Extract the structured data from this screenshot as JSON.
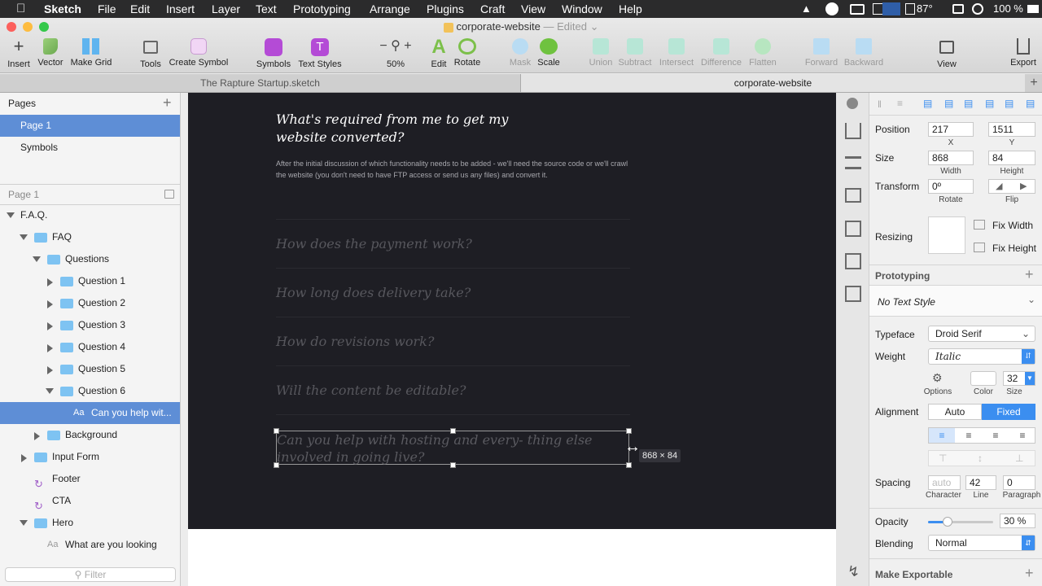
{
  "menubar": {
    "app": "Sketch",
    "items": [
      "File",
      "Edit",
      "Insert",
      "Layer",
      "Text",
      "Prototyping",
      "Arrange",
      "Plugins",
      "Craft",
      "View",
      "Window",
      "Help"
    ],
    "temperature": "87°",
    "battery": "100 %"
  },
  "window": {
    "title": "corporate-website",
    "edited": "— Edited"
  },
  "toolbar": {
    "insert": "Insert",
    "vector": "Vector",
    "make_grid": "Make Grid",
    "tools": "Tools",
    "create_symbol": "Create Symbol",
    "symbols": "Symbols",
    "text_styles": "Text Styles",
    "zoom": "50%",
    "edit": "Edit",
    "rotate": "Rotate",
    "mask": "Mask",
    "scale": "Scale",
    "union": "Union",
    "subtract": "Subtract",
    "intersect": "Intersect",
    "difference": "Difference",
    "flatten": "Flatten",
    "forward": "Forward",
    "backward": "Backward",
    "view": "View",
    "export": "Export"
  },
  "tabs": [
    "The Rapture Startup.sketch",
    "corporate-website"
  ],
  "pages": {
    "header": "Pages",
    "items": [
      "Page 1",
      "Symbols"
    ],
    "current": "Page 1"
  },
  "layers": [
    {
      "label": "F.A.Q.",
      "indent": 0,
      "type": "page"
    },
    {
      "label": "FAQ",
      "indent": 1,
      "type": "folder",
      "open": true
    },
    {
      "label": "Questions",
      "indent": 2,
      "type": "folder",
      "open": true
    },
    {
      "label": "Question 1",
      "indent": 3,
      "type": "folder"
    },
    {
      "label": "Question 2",
      "indent": 3,
      "type": "folder"
    },
    {
      "label": "Question 3",
      "indent": 3,
      "type": "folder"
    },
    {
      "label": "Question 4",
      "indent": 3,
      "type": "folder"
    },
    {
      "label": "Question 5",
      "indent": 3,
      "type": "folder"
    },
    {
      "label": "Question 6",
      "indent": 3,
      "type": "folder",
      "open": true
    },
    {
      "label": "Can you help wit...",
      "indent": 4,
      "type": "text",
      "selected": true
    },
    {
      "label": "Background",
      "indent": 2,
      "type": "folder"
    },
    {
      "label": "Input Form",
      "indent": 1,
      "type": "folder"
    },
    {
      "label": "Footer",
      "indent": 1,
      "type": "symbol"
    },
    {
      "label": "CTA",
      "indent": 1,
      "type": "symbol"
    },
    {
      "label": "Hero",
      "indent": 1,
      "type": "folder",
      "open": true
    },
    {
      "label": "What are you looking",
      "indent": 2,
      "type": "text"
    }
  ],
  "filter_placeholder": "Filter",
  "artboard": {
    "heading": "What's required from me to get my website converted?",
    "body": "After the initial discussion of which functionality needs to be added - we'll need the source code or we'll crawl the website (you don't need to have FTP access or send us any files) and convert it.",
    "questions": [
      "How does the payment work?",
      "How long does delivery take?",
      "How do revisions work?",
      "Will the content be editable?"
    ],
    "selected_text": "Can you help with hosting and every- thing else involved in going live?",
    "size_tooltip": "868 × 84"
  },
  "inspector": {
    "position_label": "Position",
    "x": "217",
    "y": "1511",
    "x_label": "X",
    "y_label": "Y",
    "size_label": "Size",
    "width": "868",
    "height": "84",
    "width_label": "Width",
    "height_label": "Height",
    "transform_label": "Transform",
    "rotate": "0º",
    "rotate_label": "Rotate",
    "flip_label": "Flip",
    "resizing_label": "Resizing",
    "fix_width": "Fix Width",
    "fix_height": "Fix Height",
    "prototyping_label": "Prototyping",
    "text_style": "No Text Style",
    "typeface_label": "Typeface",
    "typeface": "Droid Serif",
    "weight_label": "Weight",
    "weight": "Italic",
    "options_label": "Options",
    "color_label": "Color",
    "font_size": "32",
    "size_small": "Size",
    "alignment_label": "Alignment",
    "auto": "Auto",
    "fixed": "Fixed",
    "spacing_label": "Spacing",
    "char_placeholder": "auto",
    "line": "42",
    "paragraph": "0",
    "character_label": "Character",
    "line_label": "Line",
    "paragraph_label": "Paragraph",
    "opacity_label": "Opacity",
    "opacity": "30 %",
    "opacity_value": 0.3,
    "blending_label": "Blending",
    "blending": "Normal",
    "make_exportable": "Make Exportable"
  },
  "colors": {
    "selection": "#5e8ed6",
    "artboard_bg": "#1e1e24",
    "folder": "#7ec3f2",
    "symbol": "#a05ec8",
    "accent": "#3b8ef0"
  }
}
